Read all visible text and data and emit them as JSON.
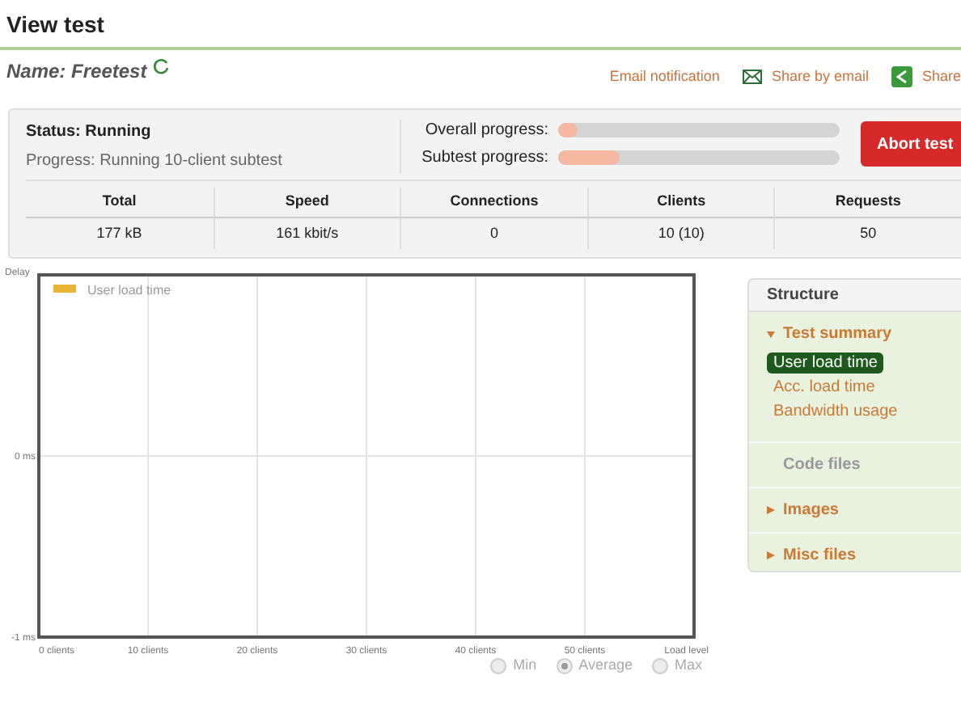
{
  "title": "View test",
  "name_line": {
    "label": "Name: Freetest",
    "loading": true
  },
  "links": [
    {
      "kind": "plain",
      "label": "Email notification"
    },
    {
      "kind": "mail",
      "label": "Share by email"
    },
    {
      "kind": "share",
      "label": "Share"
    }
  ],
  "status": {
    "label": "Status: Running",
    "progress_text": "Progress: Running 10-client subtest"
  },
  "progress": [
    {
      "label": "Overall progress:",
      "level": 0.07
    },
    {
      "label": "Subtest progress:",
      "level": 0.22
    }
  ],
  "abort_button": "Abort test",
  "stats": {
    "columns": [
      "Total",
      "Speed",
      "Connections",
      "Clients",
      "Requests"
    ],
    "values": [
      "177 kB",
      "161 kbit/s",
      "0",
      "10 (10)",
      "50"
    ]
  },
  "chart": {
    "chart_data": {
      "type": "line",
      "grid": true,
      "ylabel": "Delay",
      "xlabel": "Load level",
      "ylim": [
        -1,
        1
      ],
      "categories": [
        "0 clients",
        "10 clients",
        "20 clients",
        "30 clients",
        "40 clients",
        "50 clients"
      ],
      "yticks": [
        {
          "value": -1,
          "label": "-1 ms"
        },
        {
          "value": 0,
          "label": "0 ms"
        }
      ],
      "series": [
        {
          "name": "User load time",
          "color": "#e8b634",
          "values": [
            null,
            null,
            null,
            null,
            null,
            null
          ]
        }
      ]
    }
  },
  "view_options": [
    {
      "label": "Min",
      "selected": false
    },
    {
      "label": "Average",
      "selected": true
    },
    {
      "label": "Max",
      "selected": false
    }
  ],
  "structure": {
    "title": "Structure",
    "sections": [
      {
        "label": "Test summary",
        "expanded": true,
        "disabled": false,
        "children": [
          {
            "label": "User load time",
            "selected": true
          },
          {
            "label": "Acc. load time",
            "selected": false
          },
          {
            "label": "Bandwidth usage",
            "selected": false
          }
        ]
      },
      {
        "label": "Code files",
        "expanded": false,
        "disabled": true
      },
      {
        "label": "Images",
        "expanded": false,
        "disabled": false
      },
      {
        "label": "Misc files",
        "expanded": false,
        "disabled": false
      }
    ]
  }
}
